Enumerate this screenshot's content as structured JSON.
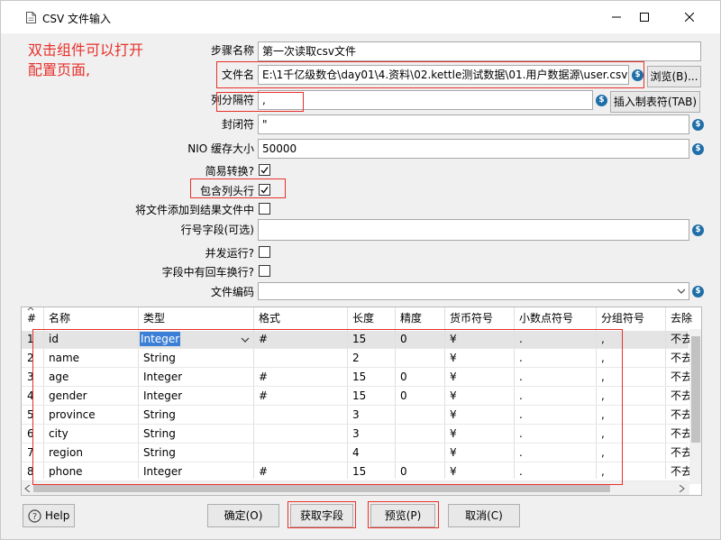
{
  "window": {
    "title": "CSV 文件输入"
  },
  "annotation": {
    "line1": "双击组件可以打开",
    "line2": "配置页面,"
  },
  "form": {
    "step_name_label": "步骤名称",
    "step_name_value": "第一次读取csv文件",
    "filename_label": "文件名",
    "filename_value": "E:\\1千亿级数仓\\day01\\4.资料\\02.kettle测试数据\\01.用户数据源\\user.csv",
    "browse_label": "浏览(B)...",
    "delimiter_label": "列分隔符",
    "delimiter_value": ",",
    "insert_tab_label": "插入制表符(TAB)",
    "enclosure_label": "封闭符",
    "enclosure_value": "\"",
    "nio_label": "NIO 缓存大小",
    "nio_value": "50000",
    "lazy_label": "简易转换?",
    "header_label": "包含列头行",
    "add_result_label": "将文件添加到结果文件中",
    "rownum_label": "行号字段(可选)",
    "parallel_label": "并发运行?",
    "newline_label": "字段中有回车换行?",
    "encoding_label": "文件编码"
  },
  "grid": {
    "columns": [
      "#",
      "名称",
      "类型",
      "格式",
      "长度",
      "精度",
      "货币符号",
      "小数点符号",
      "分组符号",
      "去除"
    ],
    "rows": [
      [
        "1",
        "id",
        "Integer",
        "#",
        "15",
        "0",
        "¥",
        ".",
        ",",
        "不去"
      ],
      [
        "2",
        "name",
        "String",
        "",
        "2",
        "",
        "¥",
        ".",
        ",",
        "不去"
      ],
      [
        "3",
        "age",
        "Integer",
        "#",
        "15",
        "0",
        "¥",
        ".",
        ",",
        "不去"
      ],
      [
        "4",
        "gender",
        "Integer",
        "#",
        "15",
        "0",
        "¥",
        ".",
        ",",
        "不去"
      ],
      [
        "5",
        "province",
        "String",
        "",
        "3",
        "",
        "¥",
        ".",
        ",",
        "不去"
      ],
      [
        "6",
        "city",
        "String",
        "",
        "3",
        "",
        "¥",
        ".",
        ",",
        "不去"
      ],
      [
        "7",
        "region",
        "String",
        "",
        "4",
        "",
        "¥",
        ".",
        ",",
        "不去"
      ],
      [
        "8",
        "phone",
        "Integer",
        "#",
        "15",
        "0",
        "¥",
        ".",
        ",",
        "不去"
      ]
    ]
  },
  "buttons": {
    "help": "Help",
    "ok": "确定(O)",
    "get_fields": "获取字段",
    "preview": "预览(P)",
    "cancel": "取消(C)"
  },
  "colors": {
    "annotation_red": "#e8302a",
    "variable_icon": "#1e6ea8",
    "selection": "#3b7fd6"
  }
}
